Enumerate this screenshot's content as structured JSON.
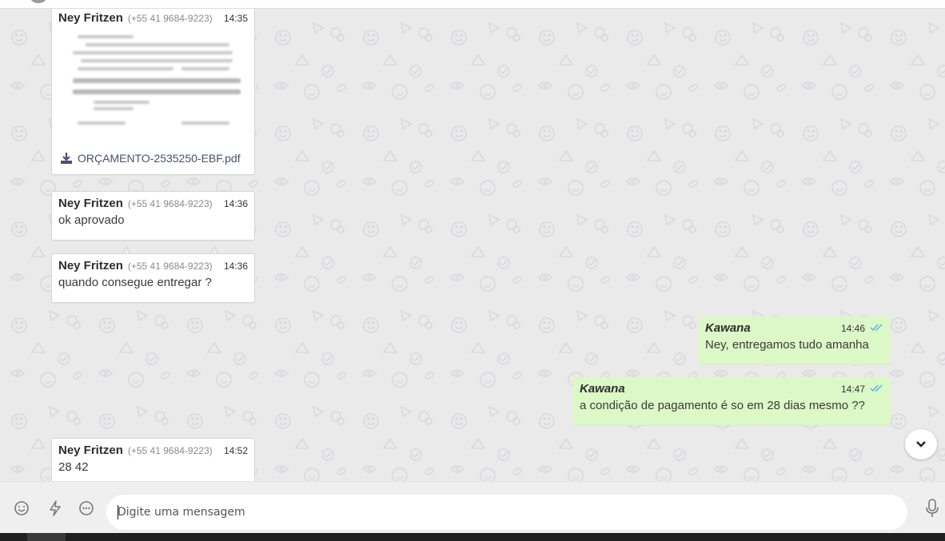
{
  "messages": [
    {
      "direction": "incoming",
      "sender": "Ney Fritzen",
      "phone": "(+55 41 9684-9223)",
      "time": "14:35",
      "attachment": {
        "filename": "ORÇAMENTO-2535250-EBF.pdf",
        "icon": "download-icon"
      }
    },
    {
      "direction": "incoming",
      "sender": "Ney Fritzen",
      "phone": "(+55 41 9684-9223)",
      "time": "14:36",
      "text": "ok aprovado"
    },
    {
      "direction": "incoming",
      "sender": "Ney Fritzen",
      "phone": "(+55 41 9684-9223)",
      "time": "14:36",
      "text": "quando consegue entregar ?"
    },
    {
      "direction": "outgoing",
      "sender": "Kawana",
      "time": "14:46",
      "text": "Ney, entregamos tudo amanha",
      "status": "read"
    },
    {
      "direction": "outgoing",
      "sender": "Kawana",
      "time": "14:47",
      "text": "a condição de pagamento é so em 28 dias mesmo ??",
      "status": "read"
    },
    {
      "direction": "incoming",
      "sender": "Ney Fritzen",
      "phone": "(+55 41 9684-9223)",
      "time": "14:52",
      "text": "28 42"
    }
  ],
  "composer": {
    "placeholder": "Digite uma mensagem",
    "value": "",
    "left_icons": [
      "emoji-icon",
      "quick-reply-icon",
      "more-options-icon"
    ],
    "right_icon": "microphone-icon"
  },
  "scroll_button_icon": "chevron-down-icon",
  "colors": {
    "incoming_bubble": "#ffffff",
    "outgoing_bubble": "#dcf8c6",
    "read_ticks": "#4fb6ec",
    "chat_background": "#eaeaea"
  }
}
